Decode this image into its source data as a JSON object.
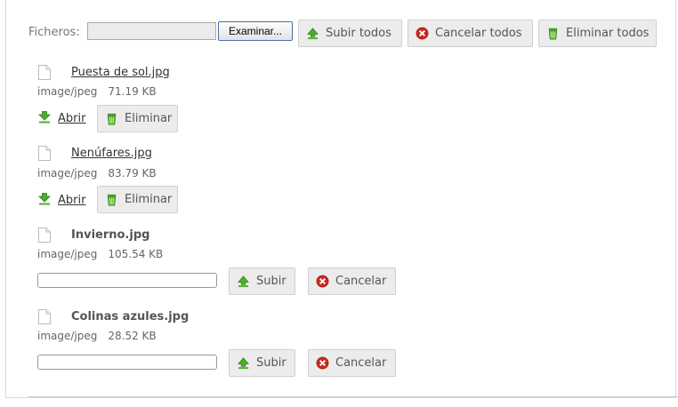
{
  "toolbar": {
    "files_label": "Ficheros:",
    "browse_label": "Examinar...",
    "upload_all_label": "Subir todos",
    "cancel_all_label": "Cancelar todos",
    "delete_all_label": "Eliminar todos"
  },
  "files": [
    {
      "name": "Puesta de sol.jpg",
      "type": "image/jpeg",
      "size": "71.19 KB",
      "open_label": "Abrir",
      "delete_label": "Eliminar"
    },
    {
      "name": "Nenúfares.jpg",
      "type": "image/jpeg",
      "size": "83.79 KB",
      "open_label": "Abrir",
      "delete_label": "Eliminar"
    },
    {
      "name": "Invierno.jpg",
      "type": "image/jpeg",
      "size": "105.54 KB",
      "upload_label": "Subir",
      "cancel_label": "Cancelar",
      "progress": 0
    },
    {
      "name": "Colinas azules.jpg",
      "type": "image/jpeg",
      "size": "28.52 KB",
      "upload_label": "Subir",
      "cancel_label": "Cancelar",
      "progress": 0
    }
  ],
  "icons": {
    "upload": "green-up-arrow-icon",
    "cancel": "red-x-circle-icon",
    "delete": "green-trash-icon",
    "open": "green-down-arrow-icon",
    "file": "document-icon"
  },
  "colors": {
    "green_icon": "#4caf2a",
    "red_icon": "#d0281c",
    "button_bg": "#ececec"
  }
}
